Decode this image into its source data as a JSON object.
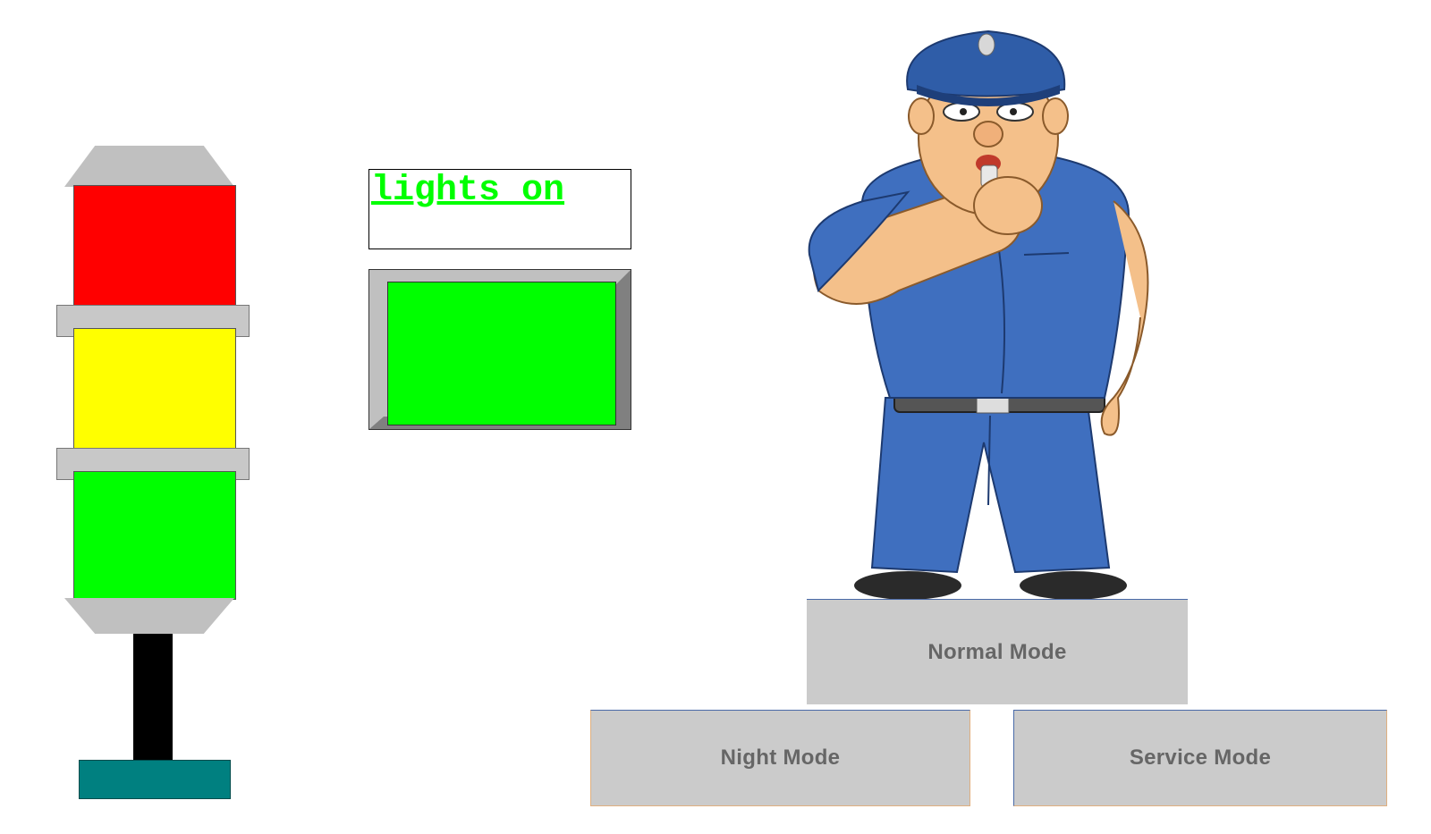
{
  "signal_tower": {
    "colors": {
      "red": "#ff0000",
      "yellow": "#ffff00",
      "green": "#00ff00",
      "base": "#008080"
    }
  },
  "status": {
    "text": "lights on",
    "color": "#00ff00"
  },
  "indicator": {
    "color": "#00ff00"
  },
  "mode_buttons": {
    "normal": "Normal Mode",
    "night": "Night Mode",
    "service": "Service Mode"
  },
  "image": {
    "icon": "traffic-police-officer-icon"
  }
}
